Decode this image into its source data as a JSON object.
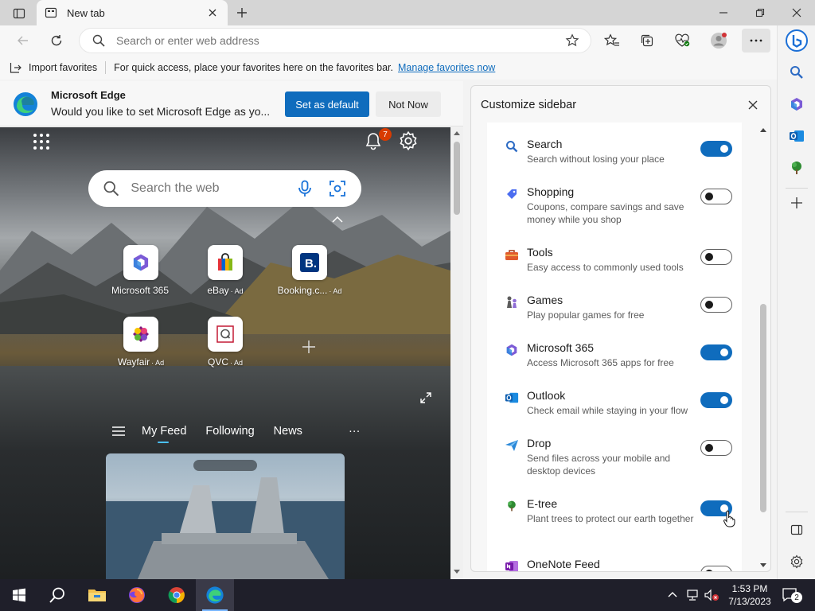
{
  "tab": {
    "title": "New tab"
  },
  "address_bar": {
    "placeholder": "Search or enter web address"
  },
  "favorites_bar": {
    "import_label": "Import favorites",
    "message": "For quick access, place your favorites here on the favorites bar.",
    "manage_link": "Manage favorites now"
  },
  "infobar": {
    "title": "Microsoft Edge",
    "message": "Would you like to set Microsoft Edge as yo...",
    "set_default_label": "Set as default",
    "not_now_label": "Not Now"
  },
  "ntp": {
    "notification_count": "7",
    "search_placeholder": "Search the web",
    "tiles": [
      {
        "label": "Microsoft 365",
        "ad": ""
      },
      {
        "label": "eBay",
        "ad": "· Ad"
      },
      {
        "label": "Booking.c...",
        "ad": "· Ad"
      },
      {
        "label": "Wayfair",
        "ad": "· Ad"
      },
      {
        "label": "QVC",
        "ad": "· Ad"
      }
    ],
    "feed_tabs": [
      "My Feed",
      "Following",
      "News"
    ],
    "more_label": "···"
  },
  "customize_panel": {
    "title": "Customize sidebar",
    "items": [
      {
        "name": "Search",
        "desc": "Search without losing your place",
        "enabled": true,
        "icon": "search-icon"
      },
      {
        "name": "Shopping",
        "desc": "Coupons, compare savings and save money while you shop",
        "enabled": false,
        "icon": "shopping-tag-icon"
      },
      {
        "name": "Tools",
        "desc": "Easy access to commonly used tools",
        "enabled": false,
        "icon": "toolbox-icon"
      },
      {
        "name": "Games",
        "desc": "Play popular games for free",
        "enabled": false,
        "icon": "chess-pieces-icon"
      },
      {
        "name": "Microsoft 365",
        "desc": "Access Microsoft 365 apps for free",
        "enabled": true,
        "icon": "microsoft365-icon"
      },
      {
        "name": "Outlook",
        "desc": "Check email while staying in your flow",
        "enabled": true,
        "icon": "outlook-icon"
      },
      {
        "name": "Drop",
        "desc": "Send files across your mobile and desktop devices",
        "enabled": false,
        "icon": "paper-plane-icon"
      },
      {
        "name": "E-tree",
        "desc": "Plant trees to protect our earth together",
        "enabled": true,
        "icon": "tree-icon"
      },
      {
        "name": "OneNote Feed",
        "desc": "",
        "enabled": false,
        "icon": "onenote-icon"
      }
    ]
  },
  "taskbar": {
    "time": "1:53 PM",
    "date": "7/13/2023",
    "notification_count": "2"
  },
  "colors": {
    "accent": "#0f6cbd",
    "badge": "#d83b01",
    "taskbar": "#1f1f2a"
  }
}
